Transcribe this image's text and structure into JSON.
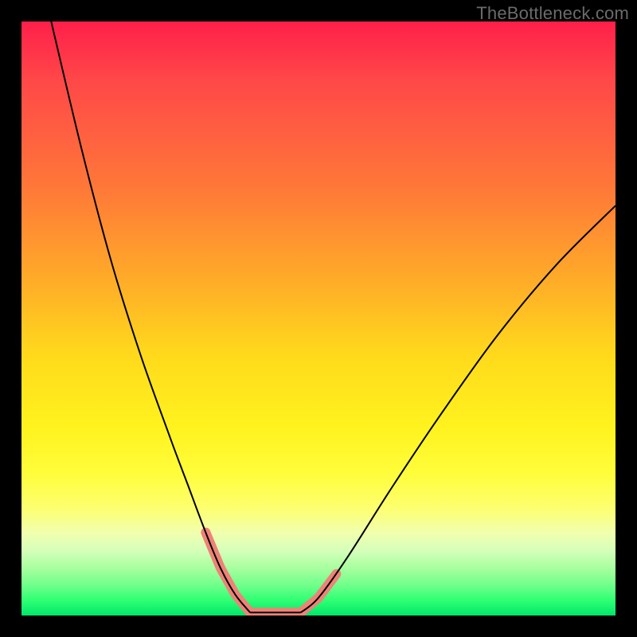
{
  "watermark": "TheBottleneck.com",
  "colors": {
    "page_bg": "#000000",
    "gradient_top": "#ff1f4a",
    "gradient_mid": "#fff21e",
    "gradient_bottom": "#00e76b",
    "curve_stroke": "#000000",
    "marker_stroke": "#ef8277"
  },
  "chart_data": {
    "type": "line",
    "title": "",
    "xlabel": "",
    "ylabel": "",
    "xlim": [
      0,
      100
    ],
    "ylim": [
      0,
      100
    ],
    "grid": false,
    "legend": false,
    "annotations": [
      "TheBottleneck.com"
    ],
    "description": "Two black curves descending from upper-left and upper-right converge to a flat minimum near the bottom center; a salmon-colored V-shaped overlay marks the region around the minimum. Background gradient encodes value from red (high) to green (low).",
    "series": [
      {
        "name": "left-curve",
        "x": [
          5,
          10,
          15,
          20,
          25,
          28,
          31,
          33.5,
          36,
          38.5
        ],
        "y": [
          100,
          79,
          60,
          44,
          30,
          22,
          14,
          8,
          3.5,
          0.5
        ]
      },
      {
        "name": "right-curve",
        "x": [
          47,
          50,
          55,
          62,
          70,
          80,
          90,
          100
        ],
        "y": [
          0.5,
          3,
          10,
          21,
          33,
          47,
          59,
          69
        ]
      },
      {
        "name": "floor",
        "x": [
          38.5,
          47
        ],
        "y": [
          0.5,
          0.5
        ]
      },
      {
        "name": "marker-left",
        "x": [
          31,
          33.5,
          36,
          38.5
        ],
        "y": [
          14,
          8,
          3.5,
          0.5
        ]
      },
      {
        "name": "marker-floor",
        "x": [
          38.5,
          47
        ],
        "y": [
          0.5,
          0.5
        ]
      },
      {
        "name": "marker-right",
        "x": [
          47,
          50,
          53
        ],
        "y": [
          0.5,
          3,
          7
        ]
      }
    ]
  }
}
